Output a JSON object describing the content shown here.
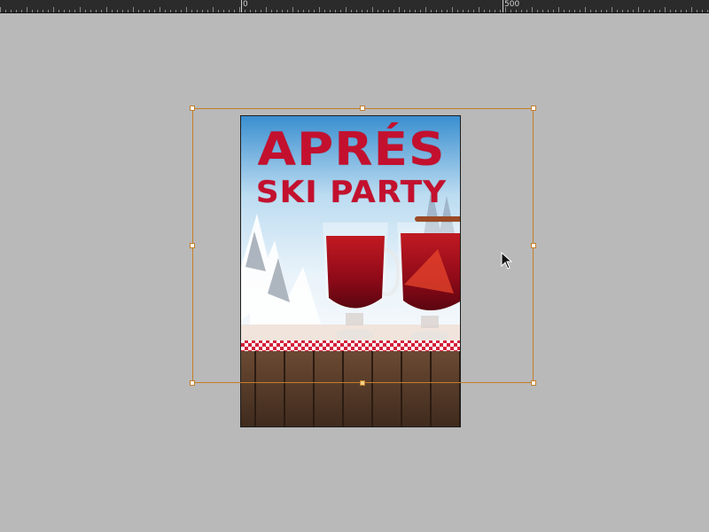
{
  "ruler": {
    "labels": [
      "0",
      "500"
    ]
  },
  "poster": {
    "title_line1": "APRÉS",
    "title_line2": "SKI PARTY"
  },
  "colors": {
    "workspace_bg": "#b9b9b9",
    "ruler_bg": "#2b2b2b",
    "selection_frame": "#c47e2a",
    "title_red": "#c3102e"
  },
  "icons": {
    "cursor": "arrow-pointer-icon"
  }
}
